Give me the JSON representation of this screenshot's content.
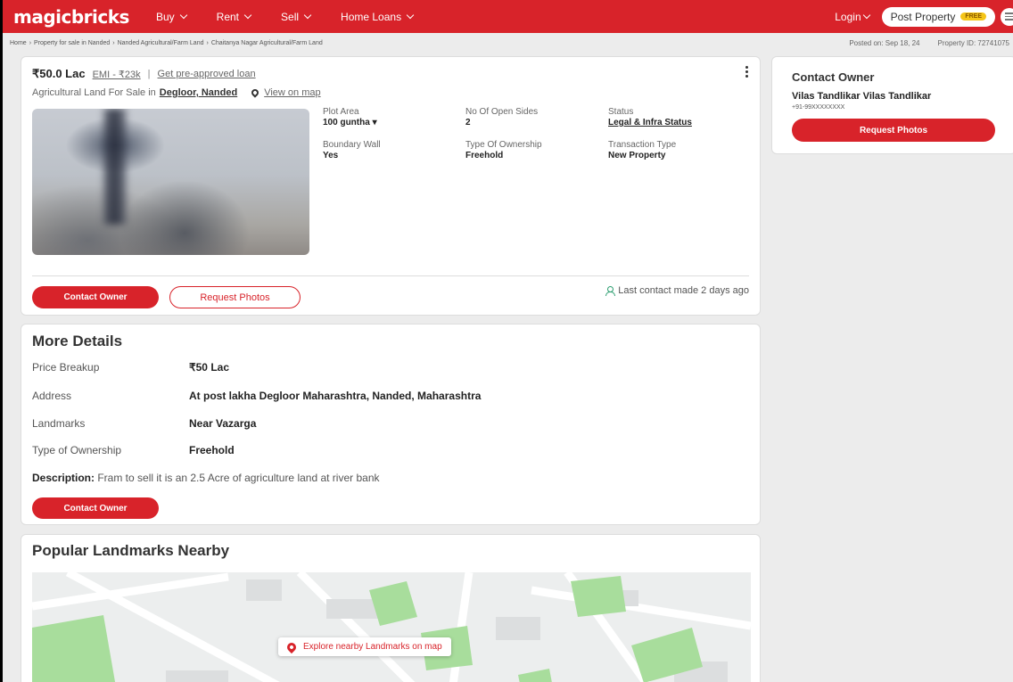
{
  "nav": {
    "logo": "magicbricks",
    "items": [
      {
        "label": "Buy"
      },
      {
        "label": "Rent"
      },
      {
        "label": "Sell"
      },
      {
        "label": "Home Loans"
      }
    ],
    "login": "Login",
    "post_property": "Post Property",
    "free_badge": "FREE"
  },
  "breadcrumb": {
    "items": [
      "Home",
      "Property for sale in Nanded",
      "Nanded Agricultural/Farm Land",
      "Chaitanya Nagar Agricultural/Farm Land"
    ],
    "posted_on": "Posted on: Sep 18, 24",
    "property_id": "Property ID: 72741075"
  },
  "property": {
    "price": "₹50.0 Lac",
    "emi": "EMI - ₹23k",
    "separator": "|",
    "preapproved": "Get pre-approved loan",
    "subtitle_prefix": "Agricultural Land For Sale in",
    "locality": "Degloor, Nanded",
    "view_on_map": "View on map",
    "facts": [
      {
        "label": "Plot Area",
        "value": "100 guntha"
      },
      {
        "label": "No Of Open Sides",
        "value": "2"
      },
      {
        "label": "Status",
        "value": "Legal & Infra Status"
      },
      {
        "label": "Boundary Wall",
        "value": "Yes"
      },
      {
        "label": "Type Of Ownership",
        "value": "Freehold"
      },
      {
        "label": "Transaction Type",
        "value": "New Property"
      }
    ],
    "contact_owner": "Contact Owner",
    "request_photos": "Request Photos",
    "last_contact": "Last contact made 2 days ago"
  },
  "more_details": {
    "title": "More Details",
    "rows": [
      {
        "label": "Price Breakup",
        "value": "₹50 Lac"
      },
      {
        "label": "Address",
        "value": "At post lakha Degloor Maharashtra, Nanded, Maharashtra"
      },
      {
        "label": "Landmarks",
        "value": "Near Vazarga"
      },
      {
        "label": "Type of Ownership",
        "value": "Freehold"
      }
    ],
    "description_label": "Description:",
    "description": " Fram to sell it is an 2.5 Acre of agriculture land at river bank",
    "contact_owner": "Contact Owner"
  },
  "landmarks": {
    "title": "Popular Landmarks Nearby",
    "explore": "Explore nearby Landmarks on map"
  },
  "contact_owner_card": {
    "title": "Contact Owner",
    "name": "Vilas Tandlikar Vilas Tandlikar",
    "phone": "+91-99XXXXXXXX",
    "request_photos": "Request Photos"
  },
  "colors": {
    "brand": "#d8232a",
    "free_badge": "#f5c518",
    "map_green": "#a8dd9c",
    "last_contact_icon": "#2a9d6f"
  }
}
